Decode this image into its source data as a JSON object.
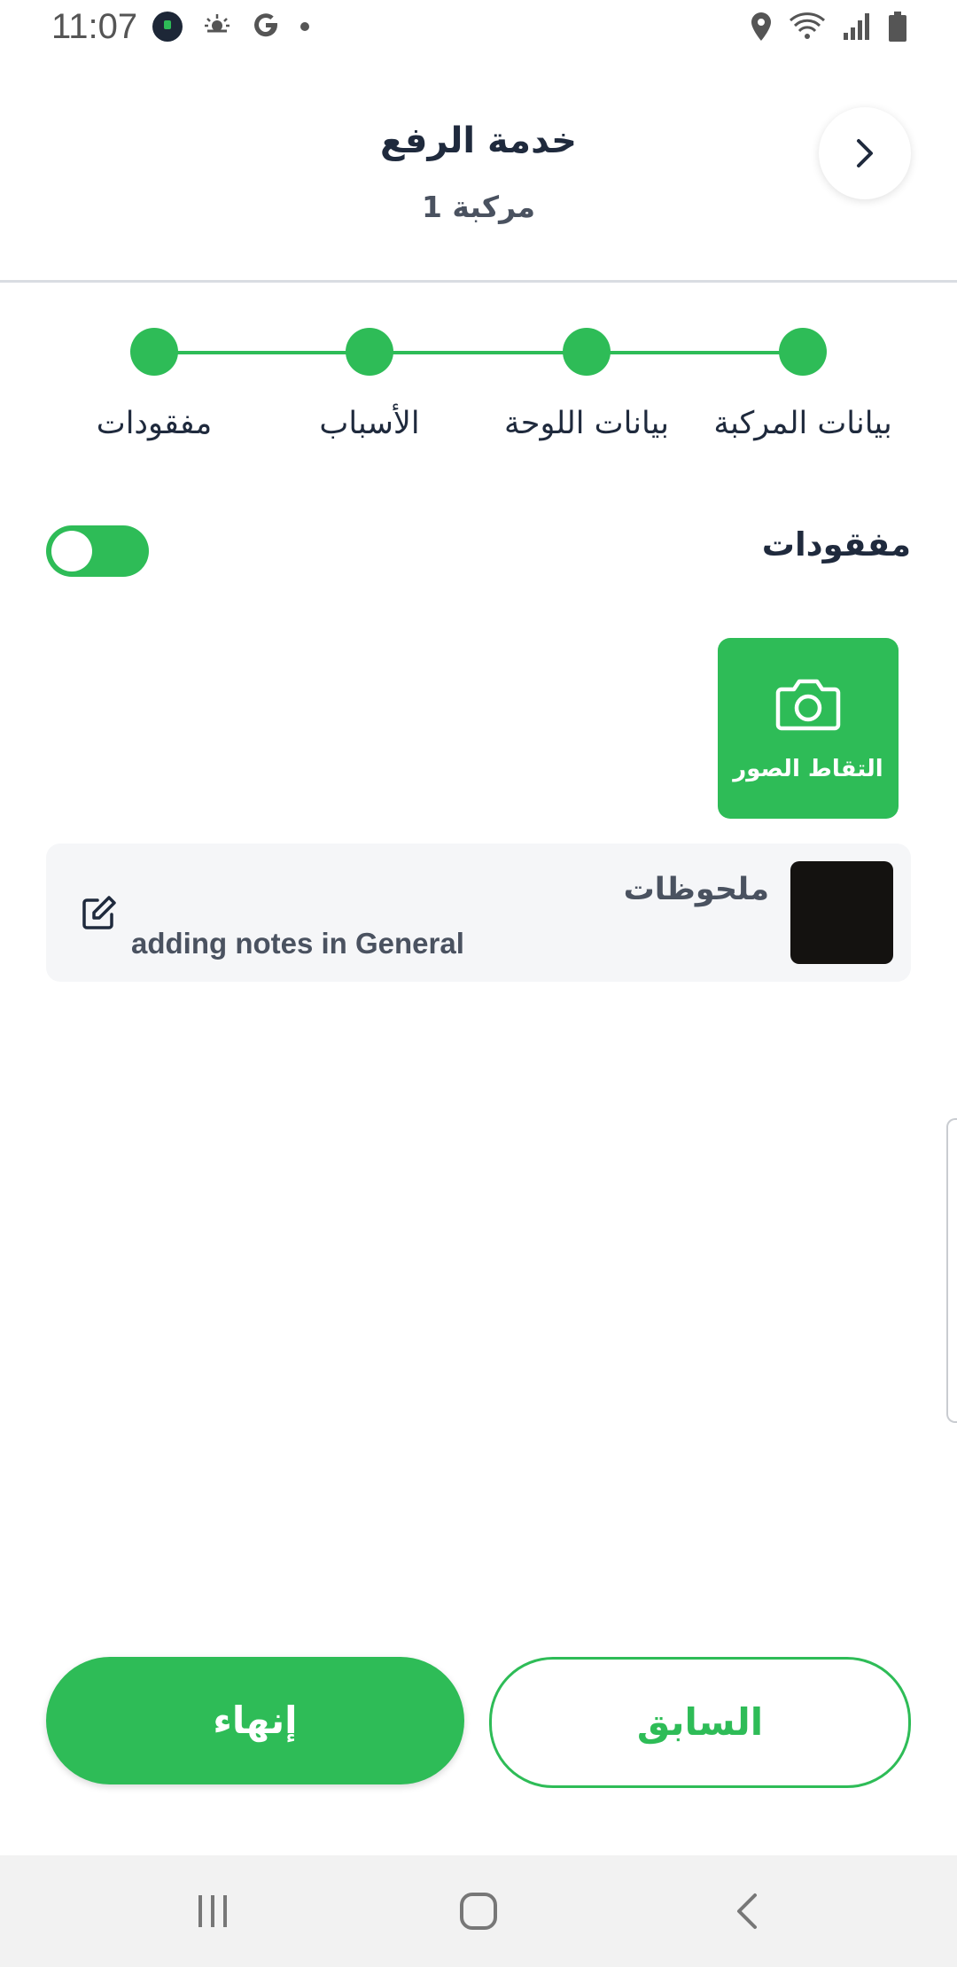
{
  "status_bar": {
    "time": "11:07",
    "left_icons": [
      "app-icon",
      "weather-icon",
      "google-icon",
      "dot-icon"
    ],
    "right_icons": [
      "location-icon",
      "wifi-icon",
      "signal-icon",
      "battery-icon"
    ]
  },
  "header": {
    "title": "خدمة الرفع",
    "subtitle": "مركبة 1",
    "back_icon": "chevron-right-icon"
  },
  "stepper": {
    "steps": [
      {
        "label": "بيانات المركبة"
      },
      {
        "label": "بيانات اللوحة"
      },
      {
        "label": "الأسباب"
      },
      {
        "label": "مفقودات"
      }
    ],
    "color": "#2ebc57"
  },
  "lost_items": {
    "title": "مفقودات",
    "toggle_on": false
  },
  "capture": {
    "label": "التقاط الصور",
    "icon": "camera-icon"
  },
  "notes": {
    "title": "ملحوظات",
    "text": "adding notes in General",
    "icon": "edit-icon"
  },
  "actions": {
    "finish_label": "إنهاء",
    "previous_label": "السابق"
  },
  "nav_bar": {
    "items": [
      "recents-icon",
      "home-icon",
      "back-icon"
    ]
  },
  "colors": {
    "accent": "#2ebc57",
    "text_dark": "#1f2a3d",
    "text_muted": "#4a5260"
  }
}
